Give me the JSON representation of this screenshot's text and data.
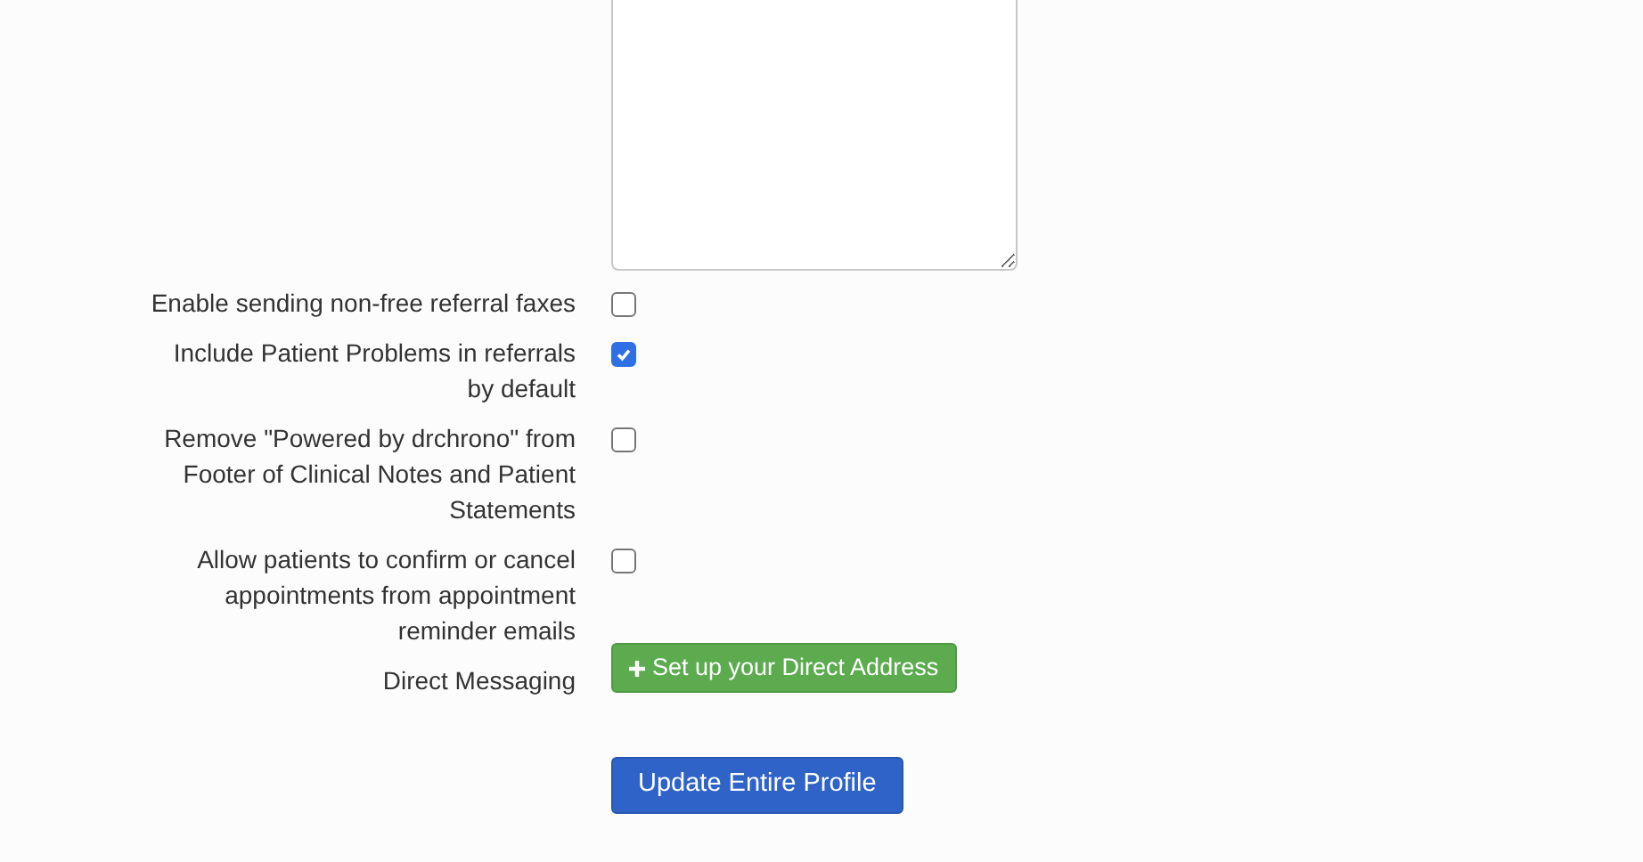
{
  "settings": [
    {
      "kind": "checkbox",
      "label": "Enable sending non-free referral faxes",
      "checked": false
    },
    {
      "kind": "checkbox",
      "label": "Include Patient Problems in referrals by default",
      "checked": true
    },
    {
      "kind": "checkbox",
      "label": "Remove \"Powered by drchrono\" from Footer of Clinical Notes and Patient Statements",
      "checked": false
    },
    {
      "kind": "checkbox",
      "label": "Allow patients to confirm or cancel appointments from appointment reminder emails",
      "checked": false
    },
    {
      "kind": "button",
      "label": "Direct Messaging",
      "button": "Set up your Direct Address"
    }
  ],
  "submit": {
    "label": "Update Entire Profile"
  }
}
